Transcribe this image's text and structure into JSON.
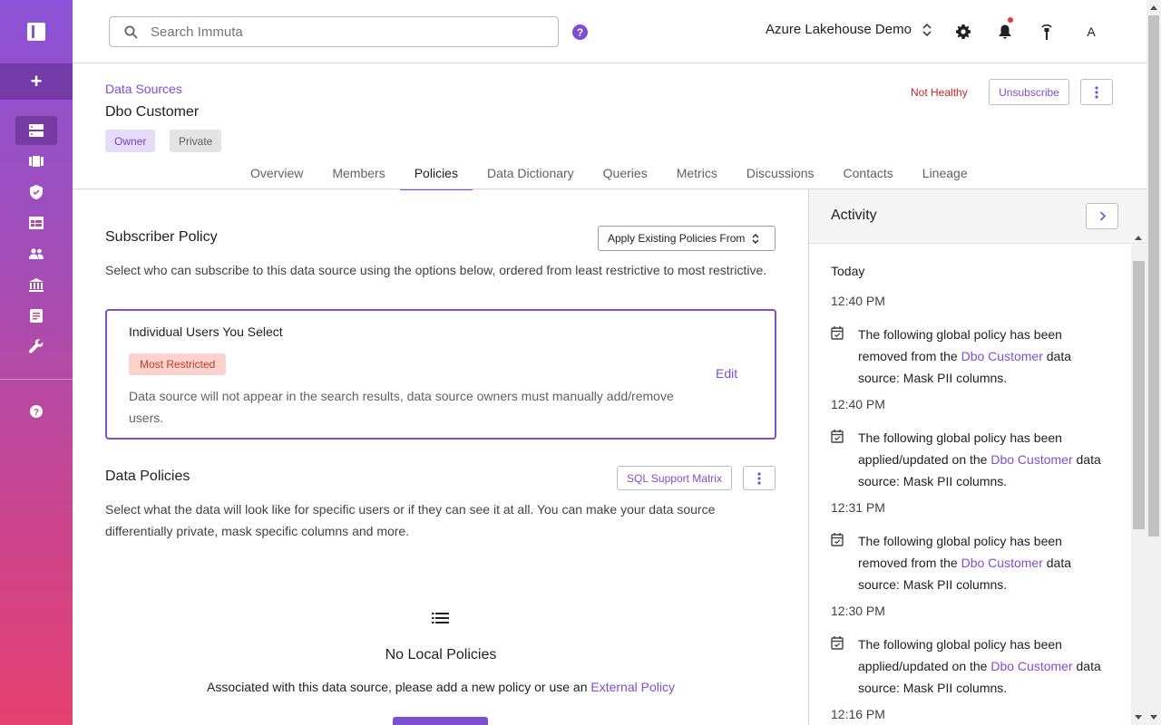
{
  "topbar": {
    "search_placeholder": "Search Immuta",
    "help_label": "?",
    "tenant_name": "Azure Lakehouse Demo",
    "avatar_initial": "A"
  },
  "header": {
    "breadcrumb": "Data Sources",
    "title": "Dbo Customer",
    "chips": [
      "Owner",
      "Private"
    ],
    "health_status": "Not Healthy",
    "unsubscribe_label": "Unsubscribe"
  },
  "tabs": [
    "Overview",
    "Members",
    "Policies",
    "Data Dictionary",
    "Queries",
    "Metrics",
    "Discussions",
    "Contacts",
    "Lineage"
  ],
  "active_tab": "Policies",
  "subscriber_policy": {
    "title": "Subscriber Policy",
    "apply_label": "Apply Existing Policies From",
    "description": "Select who can subscribe to this data source using the options below, ordered from least restrictive to most restrictive.",
    "card": {
      "title": "Individual Users You Select",
      "badge": "Most Restricted",
      "description": "Data source will not appear in the search results, data source owners must manually add/remove users.",
      "edit_label": "Edit"
    }
  },
  "data_policies": {
    "title": "Data Policies",
    "sql_matrix_label": "SQL Support Matrix",
    "description": "Select what the data will look like for specific users or if they can see it at all. You can make your data source differentially private, mask specific columns and more.",
    "empty_title": "No Local Policies",
    "empty_desc_prefix": "Associated with this data source, please add a new policy or use an ",
    "empty_desc_link": "External Policy"
  },
  "activity": {
    "title": "Activity",
    "day": "Today",
    "entries": [
      {
        "time": "12:40 PM",
        "pre": "The following global policy has been removed from the ",
        "link": "Dbo Customer",
        "post": " data source: Mask PII columns."
      },
      {
        "time": "12:40 PM",
        "pre": "The following global policy has been applied/updated on the ",
        "link": "Dbo Customer",
        "post": " data source: Mask PII columns."
      },
      {
        "time": "12:31 PM",
        "pre": "The following global policy has been removed from the ",
        "link": "Dbo Customer",
        "post": " data source: Mask PII columns."
      },
      {
        "time": "12:30 PM",
        "pre": "The following global policy has been applied/updated on the ",
        "link": "Dbo Customer",
        "post": " data source: Mask PII columns."
      },
      {
        "time": "12:16 PM",
        "pre": "",
        "link": "",
        "post": ""
      }
    ]
  },
  "colors": {
    "accent": "#7b4fd0",
    "danger": "#c62828",
    "sidebar_top": "#8a52d6",
    "sidebar_bottom": "#e5406f"
  }
}
